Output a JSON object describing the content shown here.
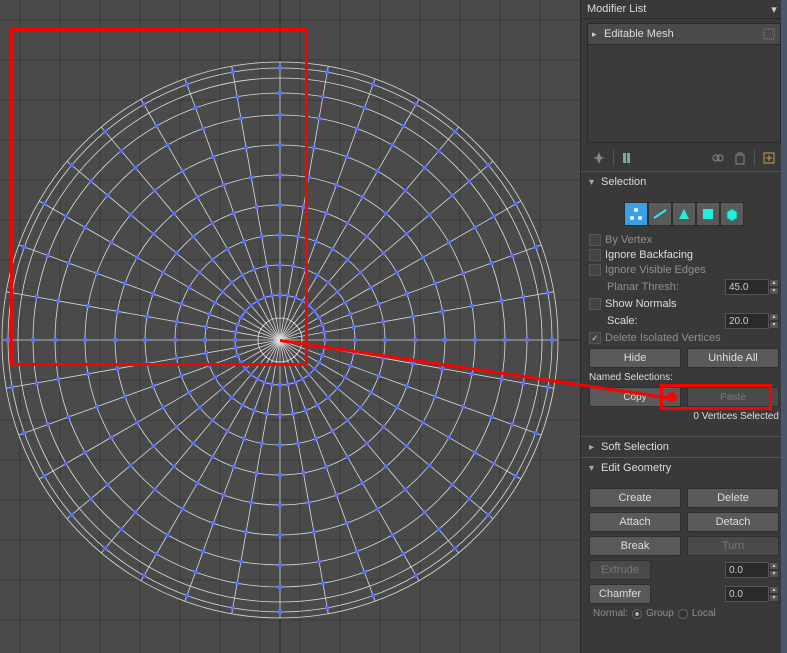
{
  "modifier_list": {
    "title": "Modifier List"
  },
  "stack": {
    "item": "Editable Mesh"
  },
  "selection": {
    "title": "Selection",
    "by_vertex": "By Vertex",
    "ignore_backfacing": "Ignore Backfacing",
    "ignore_visible_edges": "Ignore Visible Edges",
    "planar_label": "Planar Thresh:",
    "planar_value": "45.0",
    "show_normals": "Show Normals",
    "scale_label": "Scale:",
    "scale_value": "20.0",
    "delete_iso": "Delete Isolated Vertices",
    "hide": "Hide",
    "unhide": "Unhide All",
    "named_selections": "Named Selections:",
    "copy": "Copy",
    "paste": "Paste",
    "status": "0 Vertices Selected"
  },
  "soft_selection": {
    "title": "Soft Selection"
  },
  "edit_geometry": {
    "title": "Edit Geometry",
    "create": "Create",
    "delete": "Delete",
    "attach": "Attach",
    "detach": "Detach",
    "break": "Break",
    "turn": "Turn",
    "extrude": "Extrude",
    "extrude_val": "0.0",
    "chamfer": "Chamfer",
    "chamfer_val": "0.0",
    "normal_label": "Normal:",
    "group": "Group",
    "local": "Local"
  }
}
